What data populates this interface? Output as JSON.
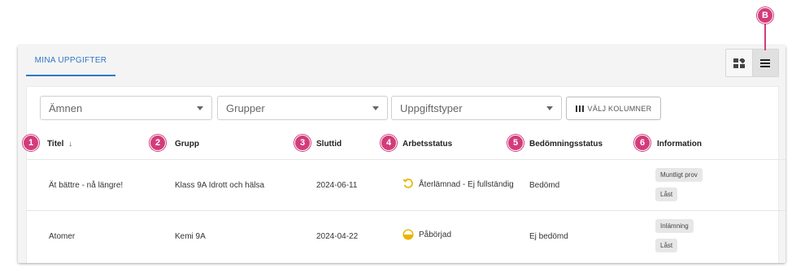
{
  "tabs": [
    {
      "label": "MINA UPPGIFTER"
    }
  ],
  "filters": {
    "subjects_placeholder": "Ämnen",
    "groups_placeholder": "Grupper",
    "types_placeholder": "Uppgiftstyper",
    "columns_button": "VÄLJ KOLUMNER"
  },
  "columns": [
    "Titel",
    "Grupp",
    "Sluttid",
    "Arbetsstatus",
    "Bedömningsstatus",
    "Information"
  ],
  "rows": [
    {
      "title": "Ät bättre - nå längre!",
      "group": "Klass 9A Idrott och hälsa",
      "deadline": "2024-06-11",
      "work_status": "Återlämnad - Ej fullständig",
      "assessment_status": "Bedömd",
      "info": [
        "Muntligt prov",
        "Låst"
      ]
    },
    {
      "title": "Atomer",
      "group": "Kemi 9A",
      "deadline": "2024-04-22",
      "work_status": "Påbörjad",
      "assessment_status": "Ej bedömd",
      "info": [
        "Inlämning",
        "Låst"
      ]
    }
  ],
  "markers": [
    "1",
    "2",
    "3",
    "4",
    "5",
    "6",
    "B"
  ],
  "colors": {
    "accent": "#2f78c4",
    "marker": "#d23c7b",
    "status_yellow": "#e8b400"
  }
}
